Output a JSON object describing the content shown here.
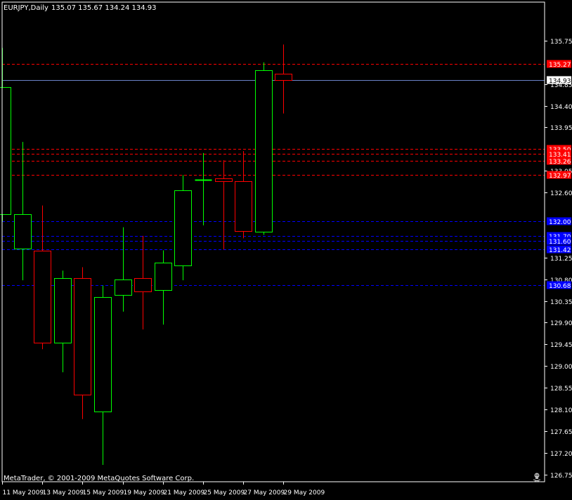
{
  "header": {
    "symbol_timeframe": "EURJPY,Daily",
    "ohlc_text": "135.07 135.67 134.24 134.93"
  },
  "footer": {
    "copyright": "MetaTrader, © 2001-2009 MetaQuotes Software Corp."
  },
  "colors": {
    "background": "#000000",
    "axis": "#ffffff",
    "bull": "#00ff00",
    "bear": "#ff0000",
    "resistance_line": "#ff0000",
    "support_line": "#0000ff",
    "current_price_line": "#6a82c8"
  },
  "chart_data": {
    "type": "candlestick",
    "symbol": "EURJPY",
    "timeframe": "Daily",
    "ylim": [
      126.6,
      136.55
    ],
    "y_ticks": [
      "135.75",
      "134.85",
      "134.40",
      "133.95",
      "133.05",
      "132.60",
      "131.25",
      "130.80",
      "130.35",
      "129.90",
      "129.45",
      "129.00",
      "128.55",
      "128.10",
      "127.65",
      "127.20",
      "126.75"
    ],
    "x_tick_labels": [
      "11 May 2009",
      "13 May 2009",
      "15 May 2009",
      "19 May 2009",
      "21 May 2009",
      "25 May 2009",
      "27 May 2009",
      "29 May 2009"
    ],
    "candles": [
      {
        "open": 132.15,
        "high": 135.6,
        "low": 132.0,
        "close": 134.78
      },
      {
        "open": 131.43,
        "high": 133.65,
        "low": 130.78,
        "close": 132.15
      },
      {
        "open": 131.4,
        "high": 132.33,
        "low": 129.35,
        "close": 129.48
      },
      {
        "open": 129.48,
        "high": 130.98,
        "low": 128.87,
        "close": 130.83
      },
      {
        "open": 130.83,
        "high": 131.05,
        "low": 127.9,
        "close": 128.4
      },
      {
        "open": 128.05,
        "high": 130.67,
        "low": 126.95,
        "close": 130.43
      },
      {
        "open": 130.47,
        "high": 131.88,
        "low": 130.13,
        "close": 130.8
      },
      {
        "open": 130.82,
        "high": 131.7,
        "low": 129.76,
        "close": 130.55
      },
      {
        "open": 130.57,
        "high": 131.4,
        "low": 129.86,
        "close": 131.15
      },
      {
        "open": 131.08,
        "high": 132.96,
        "low": 130.78,
        "close": 132.64
      },
      {
        "open": 132.87,
        "high": 133.42,
        "low": 131.92,
        "close": 132.87
      },
      {
        "open": 132.9,
        "high": 133.27,
        "low": 131.42,
        "close": 132.83
      },
      {
        "open": 132.83,
        "high": 133.46,
        "low": 131.65,
        "close": 131.8
      },
      {
        "open": 131.78,
        "high": 135.3,
        "low": 131.72,
        "close": 135.13
      },
      {
        "open": 135.07,
        "high": 135.67,
        "low": 134.24,
        "close": 134.93
      }
    ],
    "current_price": {
      "value": 134.93,
      "label": "134.93"
    },
    "horizontal_lines": [
      {
        "value": 135.27,
        "label": "135.27",
        "kind": "resistance"
      },
      {
        "value": 133.5,
        "label": "133.50",
        "kind": "resistance"
      },
      {
        "value": 133.41,
        "label": "133.41",
        "kind": "resistance"
      },
      {
        "value": 133.26,
        "label": "133.26",
        "kind": "resistance"
      },
      {
        "value": 132.97,
        "label": "132.97",
        "kind": "resistance"
      },
      {
        "value": 132.0,
        "label": "132.00",
        "kind": "support"
      },
      {
        "value": 131.7,
        "label": "131.70",
        "kind": "support"
      },
      {
        "value": 131.6,
        "label": "131.60",
        "kind": "support"
      },
      {
        "value": 131.42,
        "label": "131.42",
        "kind": "support"
      },
      {
        "value": 130.68,
        "label": "130.68",
        "kind": "support"
      }
    ]
  }
}
